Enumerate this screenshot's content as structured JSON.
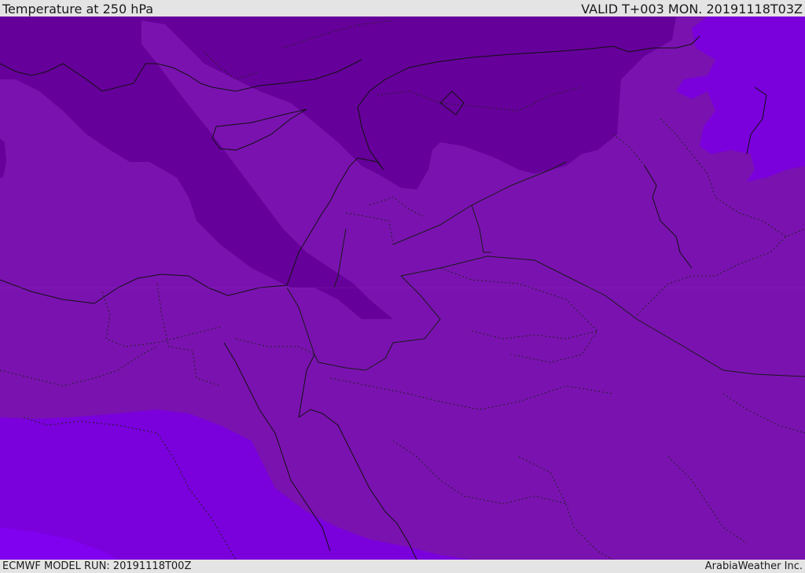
{
  "header": {
    "title": "Temperature at 250 hPa",
    "valid": "VALID T+003 MON. 20191118T03Z"
  },
  "footer": {
    "model_run": "ECMWF MODEL RUN: 20191118T00Z",
    "credit": "ArabiaWeather Inc."
  },
  "colors": {
    "background_band": "#7a12b0",
    "cold_band": "#65009a",
    "warm_band": "#7700dc",
    "warmest_band": "#8a00f0",
    "coastline": "#111111",
    "boundary": "#222222"
  }
}
